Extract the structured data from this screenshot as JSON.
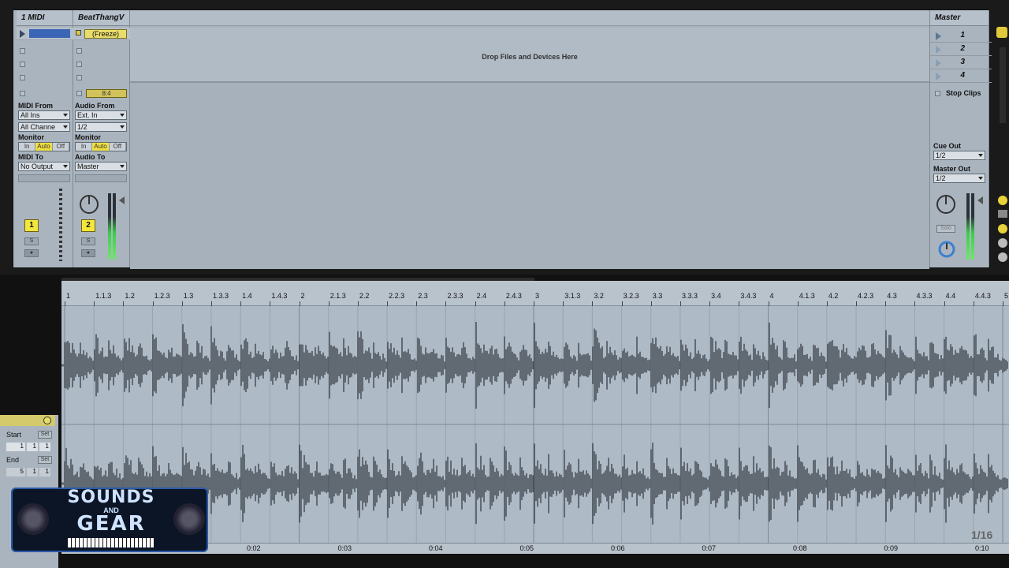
{
  "tracks": {
    "midi": {
      "title": "1 MIDI"
    },
    "audio": {
      "title": "BeatThangV",
      "clip_label": "(Freeze)",
      "position": "8:4"
    },
    "master": {
      "title": "Master"
    }
  },
  "drop_text": "Drop Files and Devices Here",
  "scenes": [
    "1",
    "2",
    "3",
    "4"
  ],
  "stop_clips": "Stop Clips",
  "io": {
    "midi_from_label": "MIDI From",
    "midi_from_value": "All Ins",
    "midi_channel": "All Channe",
    "monitor_label": "Monitor",
    "monitor_options": [
      "In",
      "Auto",
      "Off"
    ],
    "midi_to_label": "MIDI To",
    "midi_to_value": "No Output",
    "audio_from_label": "Audio From",
    "audio_from_value": "Ext. In",
    "audio_from_channel": "1/2",
    "audio_to_label": "Audio To",
    "audio_to_value": "Master",
    "cue_out_label": "Cue Out",
    "cue_out_value": "1/2",
    "master_out_label": "Master Out",
    "master_out_value": "1/2"
  },
  "mixer": {
    "track1_number": "1",
    "track2_number": "2",
    "solo": "S",
    "solo_master": "Solo"
  },
  "ruler_ticks": [
    "1",
    "1.1.3",
    "1.2",
    "1.2.3",
    "1.3",
    "1.3.3",
    "1.4",
    "1.4.3",
    "2",
    "2.1.3",
    "2.2",
    "2.2.3",
    "2.3",
    "2.3.3",
    "2.4",
    "2.4.3",
    "3",
    "3.1.3",
    "3.2",
    "3.2.3",
    "3.3",
    "3.3.3",
    "3.4",
    "3.4.3",
    "4",
    "4.1.3",
    "4.2",
    "4.2.3",
    "4.3",
    "4.3.3",
    "4.4",
    "4.4.3",
    "5"
  ],
  "time_ticks": [
    "0:02",
    "0:03",
    "0:04",
    "0:05",
    "0:06",
    "0:07",
    "0:08",
    "0:09",
    "0:10"
  ],
  "grid": "1/16",
  "clip_panel": {
    "start_label": "Start",
    "end_label": "End",
    "set_label": "Set",
    "start_values": [
      "1",
      "1",
      "1"
    ],
    "end_values": [
      "5",
      "1",
      "1"
    ]
  },
  "logo_text": {
    "line1": "SOUNDS",
    "line2": "AND",
    "line3": "GEAR"
  }
}
